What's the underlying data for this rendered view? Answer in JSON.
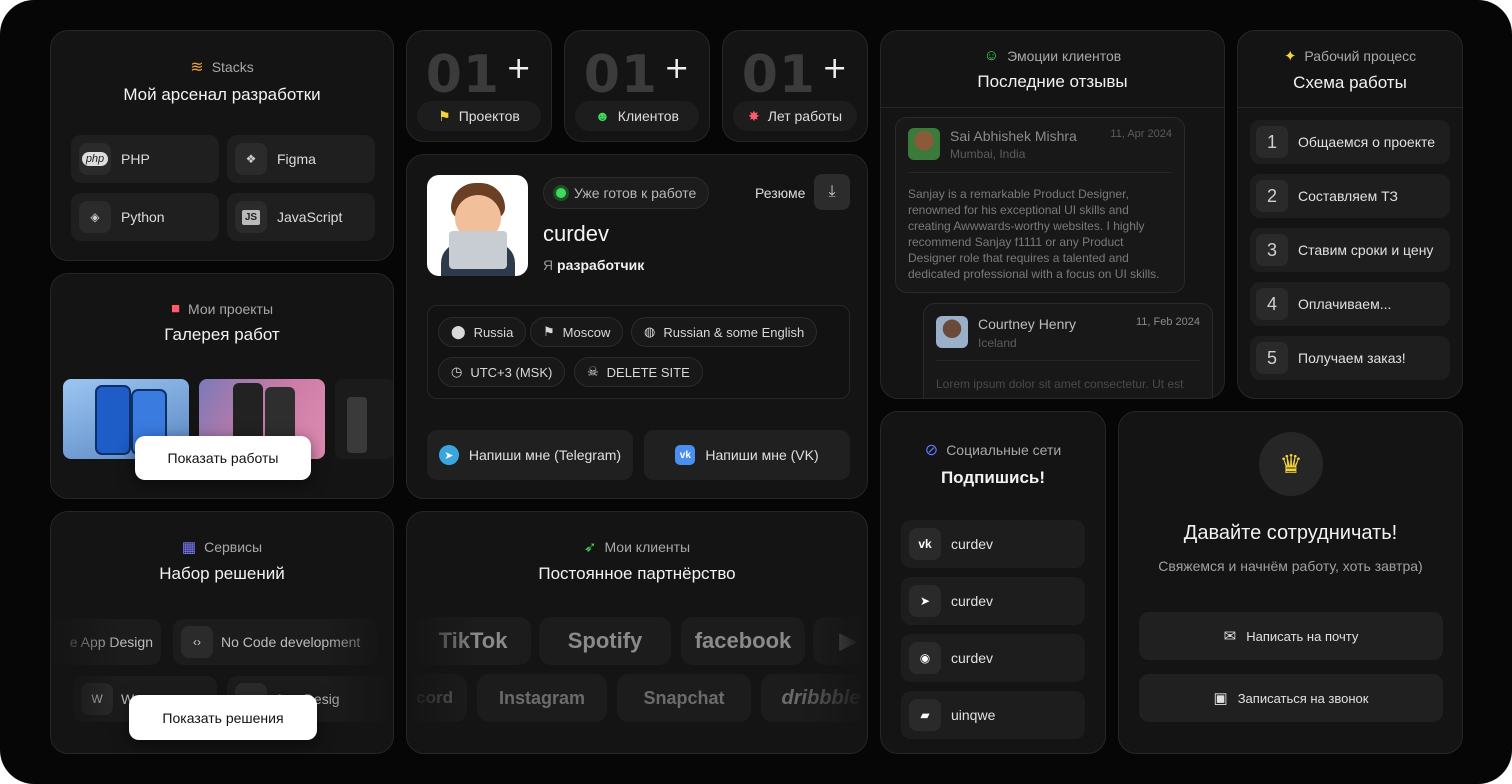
{
  "stack": {
    "kicker": "Stacks",
    "title": "Мой арсенал разработки",
    "items": [
      {
        "icon": "php",
        "label": "PHP"
      },
      {
        "icon": "figma",
        "label": "Figma"
      },
      {
        "icon": "python",
        "label": "Python"
      },
      {
        "icon": "JS",
        "label": "JavaScript"
      }
    ]
  },
  "projects": {
    "kicker": "Мои проекты",
    "title": "Галерея работ",
    "button": "Показать работы"
  },
  "services": {
    "kicker": "Сервисы",
    "title": "Набор решений",
    "row1": [
      "e App Design",
      "No Code development"
    ],
    "row2": [
      "W",
      "App Desig"
    ],
    "button": "Показать решения"
  },
  "stats": [
    {
      "num": "01",
      "plus": "+",
      "label": "Проектов"
    },
    {
      "num": "01",
      "plus": "+",
      "label": "Клиентов"
    },
    {
      "num": "01",
      "plus": "+",
      "label": "Лет работы"
    }
  ],
  "profile": {
    "status": "Уже готов к работе",
    "resume": "Резюме",
    "name": "curdev",
    "role_prefix": "Я",
    "role": "разработчик",
    "tags": [
      "Russia",
      "Moscow",
      "Russian & some English",
      "UTC+3 (MSK)",
      "DELETE SITE"
    ],
    "telegram_button": "Напиши мне (Telegram)",
    "vk_button": "Напиши мне (VK)"
  },
  "clients": {
    "kicker": "Мои клиенты",
    "title": "Постоянное партнёрство",
    "row1": [
      "TikTok",
      "Spotify",
      "facebook"
    ],
    "row2": [
      "cord",
      "Instagram",
      "Snapchat",
      "dribbble"
    ]
  },
  "reviews": {
    "kicker": "Эмоции клиентов",
    "title": "Последние отзывы",
    "items": [
      {
        "name": "Sai Abhishek Mishra",
        "location": "Mumbai, India",
        "date": "11, Apr 2024",
        "text": "Sanjay is a remarkable Product Designer, renowned for his exceptional UI skills and creating Awwwards-worthy websites. I highly recommend Sanjay f1111 or any Product Designer role that requires a talented and dedicated professional with a focus on UI skills."
      },
      {
        "name": "Courtney Henry",
        "location": "Iceland",
        "date": "11, Feb 2024",
        "text": "Lorem ipsum dolor sit amet consectetur. Ut est"
      }
    ]
  },
  "workflow": {
    "kicker": "Рабочий процесс",
    "title": "Схема работы",
    "steps": [
      {
        "n": "1",
        "label": "Общаемся о проекте"
      },
      {
        "n": "2",
        "label": "Составляем ТЗ"
      },
      {
        "n": "3",
        "label": "Ставим сроки и цену"
      },
      {
        "n": "4",
        "label": "Оплачиваем..."
      },
      {
        "n": "5",
        "label": "Получаем заказ!"
      }
    ]
  },
  "social": {
    "kicker": "Социальные сети",
    "title": "Подпишись!",
    "items": [
      {
        "icon": "vk",
        "label": "curdev"
      },
      {
        "icon": "telegram",
        "label": "curdev"
      },
      {
        "icon": "discord",
        "label": "curdev"
      },
      {
        "icon": "other",
        "label": "uinqwe"
      }
    ]
  },
  "collab": {
    "title": "Давайте сотрудничать!",
    "subtitle": "Свяжемся и начнём работу, хоть завтра)",
    "mail_button": "Написать на почту",
    "call_button": "Записаться на звонок"
  },
  "colors": {
    "bg": "#060606",
    "card": "#141414",
    "accent_green": "#3ddc5a",
    "accent_yellow": "#f5d33a"
  }
}
